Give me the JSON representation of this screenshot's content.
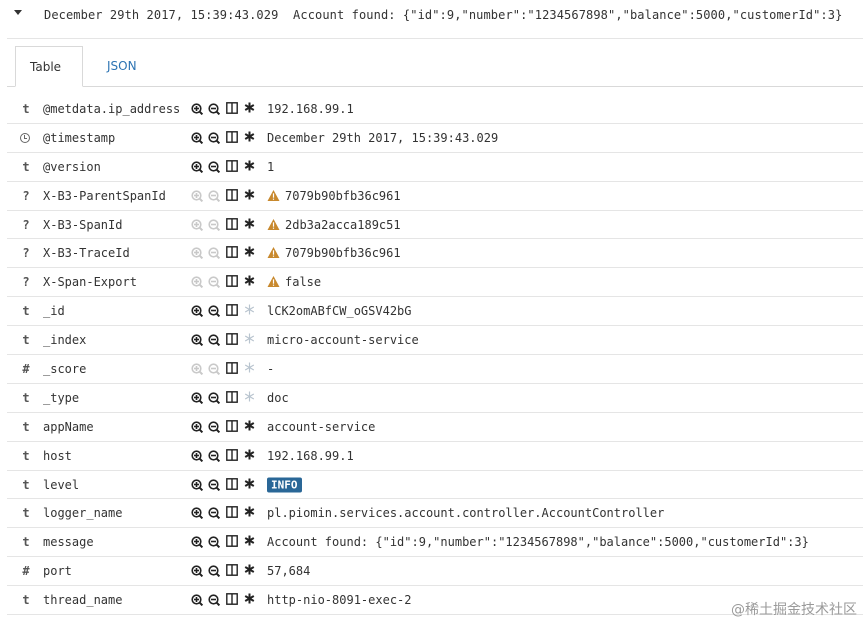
{
  "summary": {
    "timestamp": "December 29th 2017, 15:39:43.029",
    "message": "Account found: {\"id\":9,\"number\":\"1234567898\",\"balance\":5000,\"customerId\":3}"
  },
  "tabs": [
    {
      "label": "Table",
      "active": true
    },
    {
      "label": "JSON",
      "active": false
    }
  ],
  "rows": [
    {
      "type": "t",
      "field": "@metdata.ip_address",
      "value": "192.168.99.1",
      "filter_enabled": true,
      "exists": "star",
      "warning": false
    },
    {
      "type": "clock",
      "field": "@timestamp",
      "value": "December 29th 2017, 15:39:43.029",
      "filter_enabled": true,
      "exists": "star",
      "warning": false
    },
    {
      "type": "t",
      "field": "@version",
      "value": "1",
      "filter_enabled": true,
      "exists": "star",
      "warning": false
    },
    {
      "type": "?",
      "field": "X-B3-ParentSpanId",
      "value": "7079b90bfb36c961",
      "filter_enabled": false,
      "exists": "star",
      "warning": true
    },
    {
      "type": "?",
      "field": "X-B3-SpanId",
      "value": "2db3a2acca189c51",
      "filter_enabled": false,
      "exists": "star",
      "warning": true
    },
    {
      "type": "?",
      "field": "X-B3-TraceId",
      "value": "7079b90bfb36c961",
      "filter_enabled": false,
      "exists": "star",
      "warning": true
    },
    {
      "type": "?",
      "field": "X-Span-Export",
      "value": "false",
      "filter_enabled": false,
      "exists": "star",
      "warning": true
    },
    {
      "type": "t",
      "field": "_id",
      "value": "lCK2omABfCW_oGSV42bG",
      "filter_enabled": true,
      "exists": "disabled",
      "warning": false
    },
    {
      "type": "t",
      "field": "_index",
      "value": "micro-account-service",
      "filter_enabled": true,
      "exists": "disabled",
      "warning": false
    },
    {
      "type": "#",
      "field": "_score",
      "value": " -",
      "filter_enabled": false,
      "exists": "disabled",
      "warning": false
    },
    {
      "type": "t",
      "field": "_type",
      "value": "doc",
      "filter_enabled": true,
      "exists": "disabled",
      "warning": false
    },
    {
      "type": "t",
      "field": "appName",
      "value": "account-service",
      "filter_enabled": true,
      "exists": "star",
      "warning": false
    },
    {
      "type": "t",
      "field": "host",
      "value": "192.168.99.1",
      "filter_enabled": true,
      "exists": "star",
      "warning": false
    },
    {
      "type": "t",
      "field": "level",
      "value": "INFO",
      "filter_enabled": true,
      "exists": "star",
      "warning": false,
      "badge": true
    },
    {
      "type": "t",
      "field": "logger_name",
      "value": "pl.piomin.services.account.controller.AccountController",
      "filter_enabled": true,
      "exists": "star",
      "warning": false
    },
    {
      "type": "t",
      "field": "message",
      "value": "Account found: {\"id\":9,\"number\":\"1234567898\",\"balance\":5000,\"customerId\":3}",
      "filter_enabled": true,
      "exists": "star",
      "warning": false
    },
    {
      "type": "#",
      "field": "port",
      "value": "57,684",
      "filter_enabled": true,
      "exists": "star",
      "warning": false
    },
    {
      "type": "t",
      "field": "thread_name",
      "value": "http-nio-8091-exec-2",
      "filter_enabled": true,
      "exists": "star",
      "warning": false
    }
  ],
  "watermark": "@稀土掘金技术社区",
  "colors": {
    "link": "#2d74b3",
    "badge": "#2a6797",
    "warning": "#c8892e",
    "border": "#e5e5e5"
  }
}
